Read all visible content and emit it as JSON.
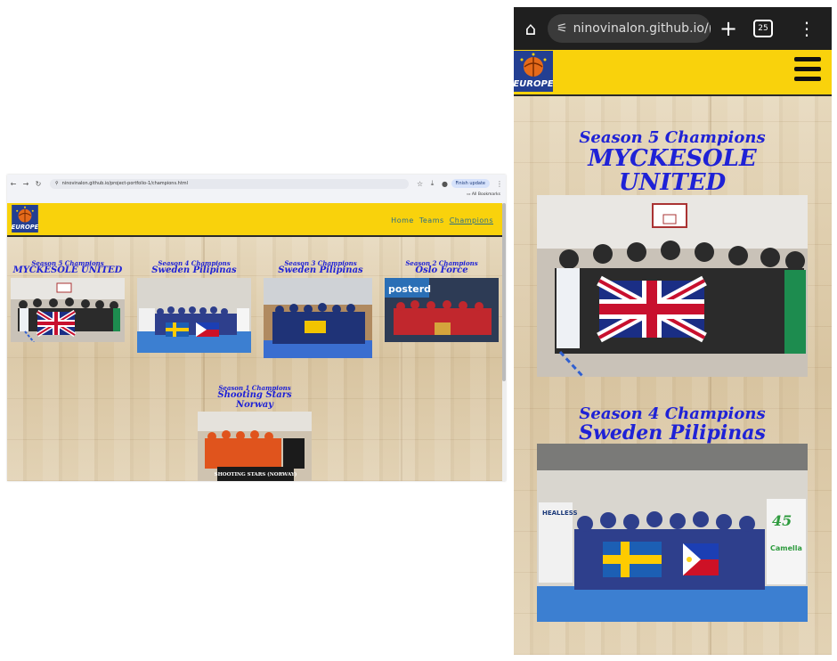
{
  "desktop": {
    "url": "ninovinalon.github.io/project-portfolio-1/champions.html",
    "update_label": "Finish update",
    "bookmarks_label": "All Bookmarks",
    "nav": [
      "Home",
      "Teams",
      "Champions"
    ],
    "active_nav": "Champions"
  },
  "mobile": {
    "url": "ninovinalon.github.io/projec",
    "tab_count": "25"
  },
  "logo_text": "EUROPE",
  "champions": [
    {
      "season": "Season 5 Champions",
      "team": "MYCKESOLE UNITED"
    },
    {
      "season": "Season 4 Champions",
      "team": "Sweden Pilipinas"
    },
    {
      "season": "Season 3 Champions",
      "team": "Sweden Pilipinas"
    },
    {
      "season": "Season 2 Champions",
      "team": "Oslo Force"
    },
    {
      "season": "Season 1 Champions",
      "team": "Shooting Stars Norway"
    }
  ],
  "photo_captions": {
    "season2_banner": "posterd",
    "season1_banner": "SHOOTING STARS (NORWAY)",
    "season4_banner_left": "HEALLESS",
    "season4_banner_right": "Camella",
    "season4_banner_num": "45"
  },
  "colors": {
    "header_yellow": "#f9d20c",
    "title_blue": "#1f22d6",
    "nav_teal": "#2a6d88"
  }
}
